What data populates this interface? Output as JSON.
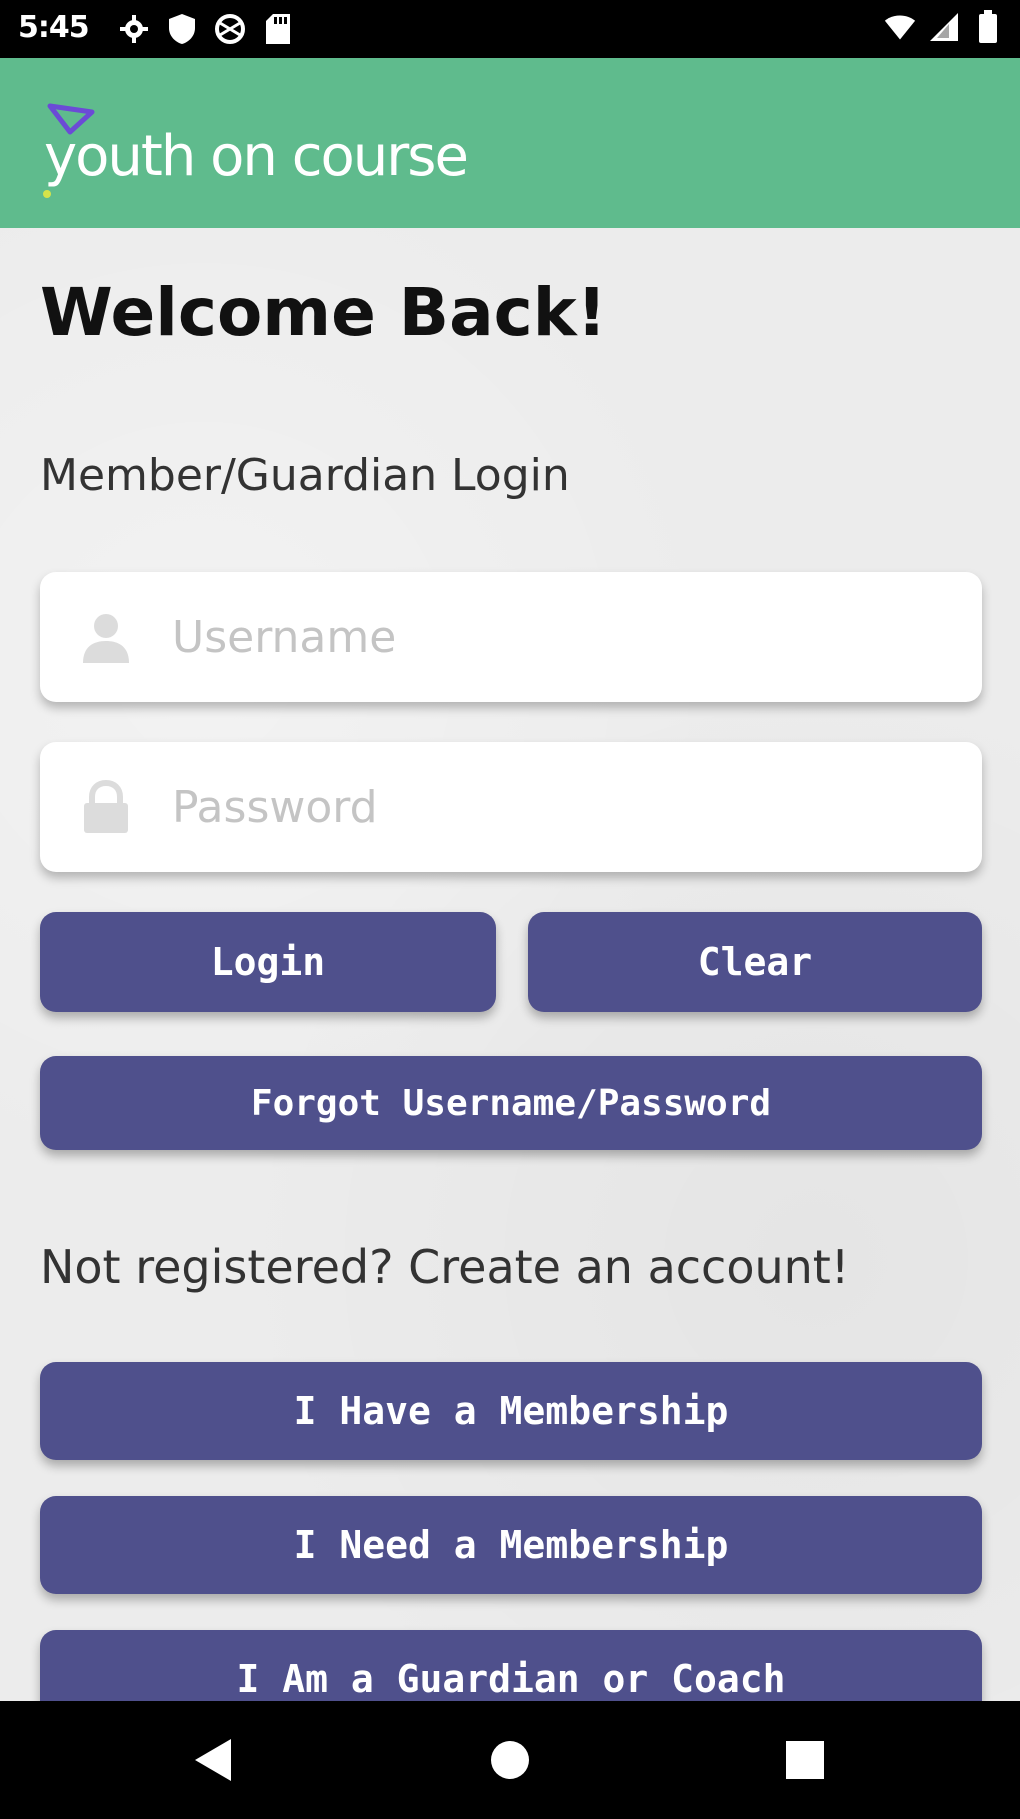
{
  "status_bar": {
    "time": "5:45",
    "left_icons": [
      "gear-icon",
      "shield-icon",
      "globe-icon",
      "sd-card-icon"
    ],
    "right_icons": [
      "wifi-icon",
      "cell-signal-icon",
      "battery-icon"
    ]
  },
  "header": {
    "logo_text": "youth on course",
    "brand_color": "#5fbb8d",
    "logo_accent": "#6b4bd6"
  },
  "main": {
    "welcome_title": "Welcome Back!",
    "login_section_label": "Member/Guardian Login",
    "username_placeholder": "Username",
    "password_placeholder": "Password",
    "login_button": "Login",
    "clear_button": "Clear",
    "forgot_button": "Forgot Username/Password",
    "create_account_label": "Not registered? Create an account!",
    "have_membership_button": "I Have a Membership",
    "need_membership_button": "I Need a Membership",
    "guardian_coach_button": "I Am a Guardian or Coach",
    "button_color": "#4f508c"
  },
  "nav_bar": {
    "icons": [
      "back-icon",
      "home-icon",
      "recents-icon"
    ]
  }
}
